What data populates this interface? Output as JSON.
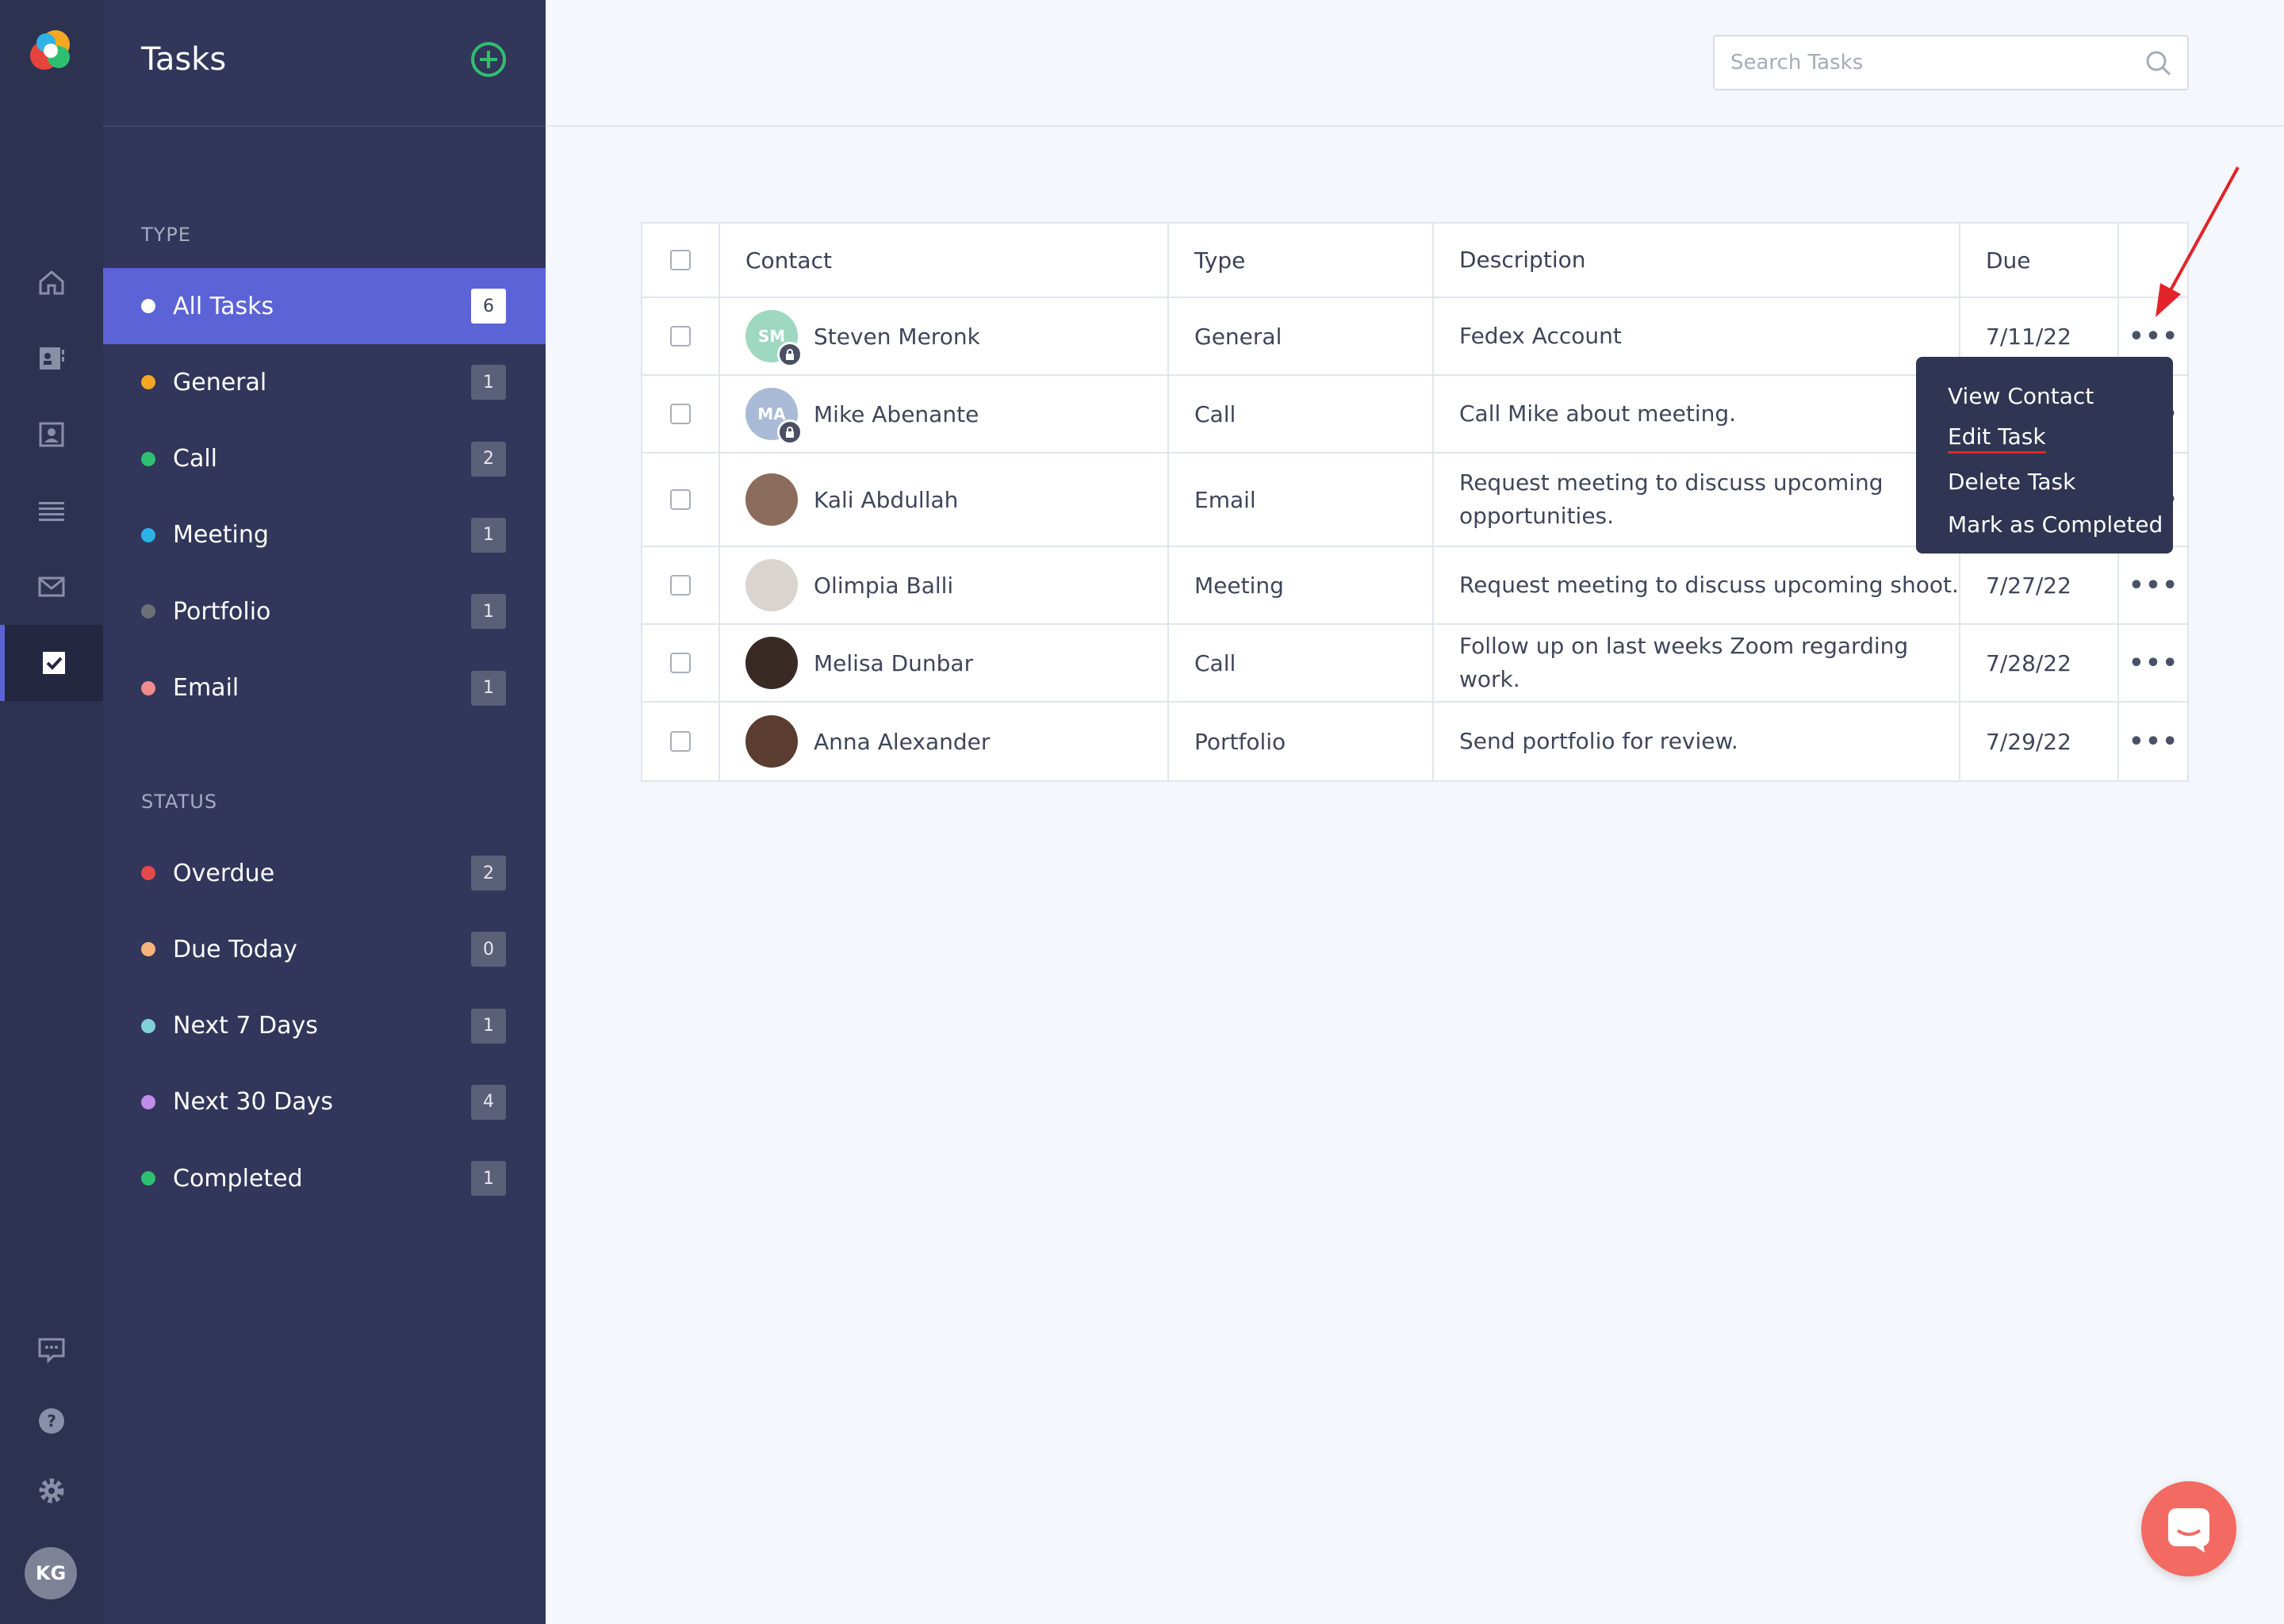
{
  "sidebar": {
    "title": "Tasks",
    "type_label": "TYPE",
    "status_label": "STATUS",
    "type_items": [
      {
        "label": "All Tasks",
        "count": "6",
        "color": "#ffffff"
      },
      {
        "label": "General",
        "count": "1",
        "color": "#f5a623"
      },
      {
        "label": "Call",
        "count": "2",
        "color": "#2fbf71"
      },
      {
        "label": "Meeting",
        "count": "1",
        "color": "#2bb3e6"
      },
      {
        "label": "Portfolio",
        "count": "1",
        "color": "#6d6f78"
      },
      {
        "label": "Email",
        "count": "1",
        "color": "#f28b8b"
      }
    ],
    "status_items": [
      {
        "label": "Overdue",
        "count": "2",
        "color": "#e54848"
      },
      {
        "label": "Due Today",
        "count": "0",
        "color": "#f5b27a"
      },
      {
        "label": "Next 7 Days",
        "count": "1",
        "color": "#7fd1d8"
      },
      {
        "label": "Next 30 Days",
        "count": "4",
        "color": "#c08ee8"
      },
      {
        "label": "Completed",
        "count": "1",
        "color": "#2fbf71"
      }
    ]
  },
  "rail": {
    "avatar_initials": "KG"
  },
  "search": {
    "placeholder": "Search Tasks"
  },
  "table": {
    "headers": {
      "contact": "Contact",
      "type": "Type",
      "description": "Description",
      "due": "Due"
    },
    "rows": [
      {
        "initials": "SM",
        "name": "Steven Meronk",
        "type": "General",
        "description": "Fedex Account",
        "due": "7/11/22",
        "avatar_color": "#9fd8c0",
        "locked": true
      },
      {
        "initials": "MA",
        "name": "Mike Abenante",
        "type": "Call",
        "description": "Call Mike about meeting.",
        "due": "",
        "avatar_color": "#a8bad6",
        "locked": true
      },
      {
        "initials": "",
        "name": "Kali Abdullah",
        "type": "Email",
        "description": "Request meeting to discuss upcoming opportunities.",
        "due": "",
        "avatar_color": "#8a6b5c",
        "locked": false
      },
      {
        "initials": "",
        "name": "Olimpia Balli",
        "type": "Meeting",
        "description": "Request meeting to discuss upcoming shoot.",
        "due": "7/27/22",
        "avatar_color": "#d9d4cf",
        "locked": false
      },
      {
        "initials": "",
        "name": "Melisa Dunbar",
        "type": "Call",
        "description": "Follow up on last weeks Zoom regarding work.",
        "due": "7/28/22",
        "avatar_color": "#3a2a26",
        "locked": false
      },
      {
        "initials": "",
        "name": "Anna Alexander",
        "type": "Portfolio",
        "description": "Send portfolio for review.",
        "due": "7/29/22",
        "avatar_color": "#5a3d30",
        "locked": false
      }
    ],
    "action_label": "•••"
  },
  "menu": {
    "items": [
      "View Contact",
      "Edit Task",
      "Delete Task",
      "Mark as Completed"
    ]
  },
  "colors": {
    "accent": "#5b63d6",
    "sidebar_bg": "#31365a",
    "rail_bg": "#2d3250",
    "chat": "#f26a62",
    "annotation": "#e2242a"
  }
}
